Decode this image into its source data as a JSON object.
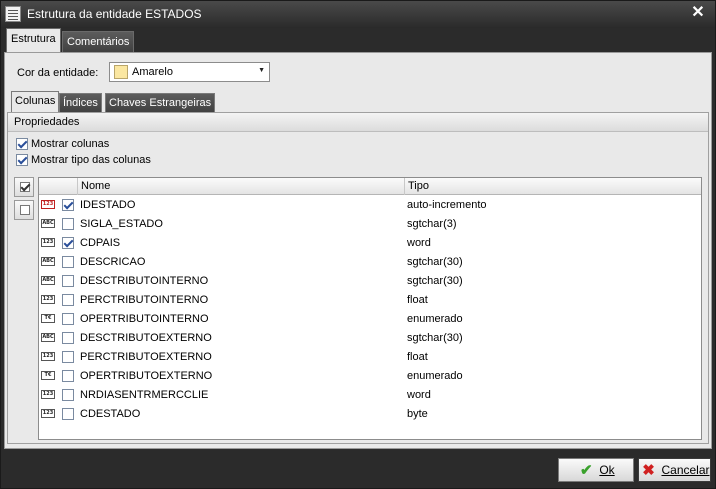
{
  "window": {
    "title": "Estrutura da entidade ESTADOS",
    "icon": "table-structure-icon",
    "close_icon": "close-icon"
  },
  "top_tabs": [
    {
      "label": "Estrutura",
      "active": true
    },
    {
      "label": "Comentários",
      "active": false
    }
  ],
  "cor": {
    "label": "Cor da entidade:",
    "value": "Amarelo",
    "swatch_color": "#fbe7a1"
  },
  "inner_tabs": [
    {
      "label": "Colunas",
      "active": true
    },
    {
      "label": "Índices",
      "active": false
    },
    {
      "label": "Chaves Estrangeiras",
      "active": false
    }
  ],
  "propriedades": {
    "header": "Propriedades",
    "mostrar_colunas": {
      "label": "Mostrar colunas",
      "checked": true
    },
    "mostrar_tipo": {
      "label": "Mostrar tipo das colunas",
      "checked": true
    }
  },
  "side_buttons": [
    "check-all-icon",
    "uncheck-all-icon"
  ],
  "grid": {
    "columns": [
      "Nome",
      "Tipo"
    ],
    "rows": [
      {
        "icon": "123",
        "key": true,
        "checked": true,
        "name": "IDESTADO",
        "type": "auto-incremento"
      },
      {
        "icon": "ABC",
        "key": false,
        "checked": false,
        "name": "SIGLA_ESTADO",
        "type": "sgtchar(3)"
      },
      {
        "icon": "123",
        "key": false,
        "checked": true,
        "name": "CDPAIS",
        "type": "word"
      },
      {
        "icon": "ABC",
        "key": false,
        "checked": false,
        "name": "DESCRICAO",
        "type": "sgtchar(30)"
      },
      {
        "icon": "ABC",
        "key": false,
        "checked": false,
        "name": "DESCTRIBUTOINTERNO",
        "type": "sgtchar(30)"
      },
      {
        "icon": "123",
        "key": false,
        "checked": false,
        "name": "PERCTRIBUTOINTERNO",
        "type": "float"
      },
      {
        "icon": "T€",
        "key": false,
        "checked": false,
        "name": "OPERTRIBUTOINTERNO",
        "type": "enumerado"
      },
      {
        "icon": "ABC",
        "key": false,
        "checked": false,
        "name": "DESCTRIBUTOEXTERNO",
        "type": "sgtchar(30)"
      },
      {
        "icon": "123",
        "key": false,
        "checked": false,
        "name": "PERCTRIBUTOEXTERNO",
        "type": "float"
      },
      {
        "icon": "T€",
        "key": false,
        "checked": false,
        "name": "OPERTRIBUTOEXTERNO",
        "type": "enumerado"
      },
      {
        "icon": "123",
        "key": false,
        "checked": false,
        "name": "NRDIASENTRMERCCLIE",
        "type": "word"
      },
      {
        "icon": "123",
        "key": false,
        "checked": false,
        "name": "CDESTADO",
        "type": "byte"
      }
    ]
  },
  "buttons": {
    "ok": {
      "label": "Ok",
      "icon": "checkmark-icon"
    },
    "cancel": {
      "label": "Cancelar",
      "icon": "x-icon"
    }
  }
}
